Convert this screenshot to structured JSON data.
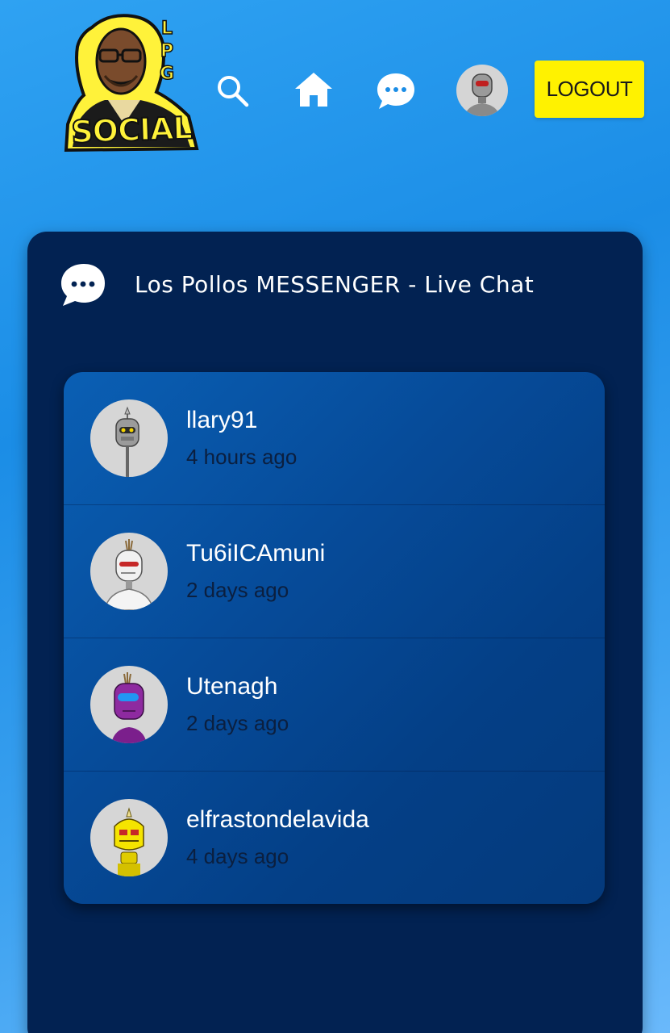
{
  "header": {
    "logo": {
      "letters": [
        "L",
        "P",
        "G"
      ],
      "word": "SOCIAL"
    },
    "nav": {
      "search_icon": "search-icon",
      "home_icon": "home-icon",
      "chat_icon": "chat-bubble-icon",
      "avatar": "robot-avatar"
    },
    "logout_label": "LOGOUT"
  },
  "panel": {
    "icon": "chat-bubble-icon",
    "title": "Los Pollos MESSENGER - Live Chat"
  },
  "chats": [
    {
      "name": "llary91",
      "time": "4 hours ago",
      "avatar": "gray-robot-avatar"
    },
    {
      "name": "Tu6iICAmuni",
      "time": "2 days ago",
      "avatar": "white-robot-avatar"
    },
    {
      "name": "Utenagh",
      "time": "2 days ago",
      "avatar": "purple-robot-avatar"
    },
    {
      "name": "elfrastondelavida",
      "time": "4 days ago",
      "avatar": "yellow-robot-avatar"
    }
  ],
  "colors": {
    "accent": "#fff200",
    "panel": "#022252",
    "list": "#064b99",
    "background": "#2fa2f2"
  }
}
